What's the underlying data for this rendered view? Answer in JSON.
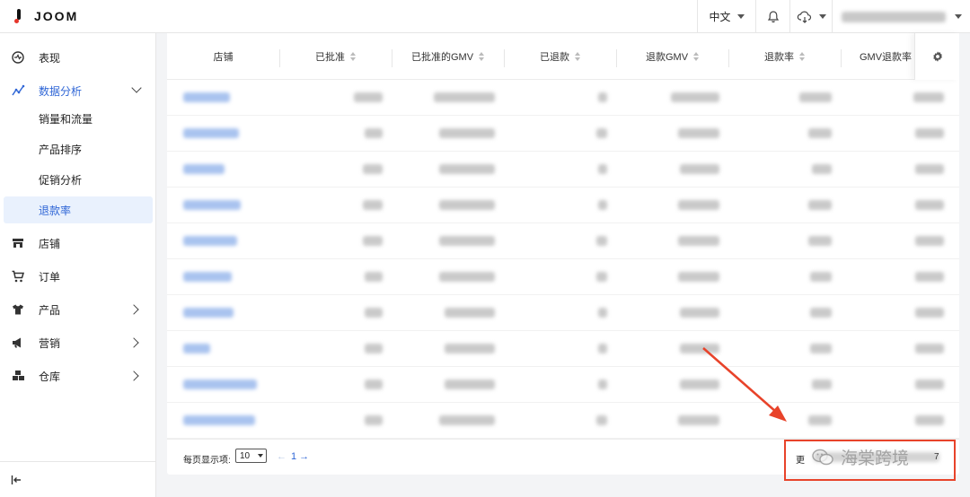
{
  "app": {
    "logo_text": "JOOM",
    "accent": "#2f66d6",
    "brand_dot": "#e5352b"
  },
  "header": {
    "language": "中文",
    "bell_icon": "bell-icon",
    "cloud_icon": "cloud-icon"
  },
  "sidebar": {
    "items": [
      {
        "label": "表现",
        "icon": "dashboard-icon"
      },
      {
        "label": "数据分析",
        "icon": "analytics-icon"
      },
      {
        "label": "店铺",
        "icon": "store-icon"
      },
      {
        "label": "订单",
        "icon": "cart-icon"
      },
      {
        "label": "产品",
        "icon": "tshirt-icon"
      },
      {
        "label": "营销",
        "icon": "megaphone-icon"
      },
      {
        "label": "仓库",
        "icon": "warehouse-icon"
      }
    ],
    "analytics_sub": [
      "销量和流量",
      "产品排序",
      "促销分析",
      "退款率"
    ]
  },
  "table": {
    "columns": [
      "店铺",
      "已批准",
      "已批准的GMV",
      "已退款",
      "退款GMV",
      "退款率",
      "GMV退款率"
    ],
    "row_count": 10
  },
  "footer": {
    "per_page_label": "每页显示项:",
    "per_page_value": "10",
    "prev": "←",
    "page": "1",
    "next": "→",
    "update_prefix": "更",
    "update_suffix": "7"
  },
  "watermark": {
    "text": "海棠跨境"
  }
}
